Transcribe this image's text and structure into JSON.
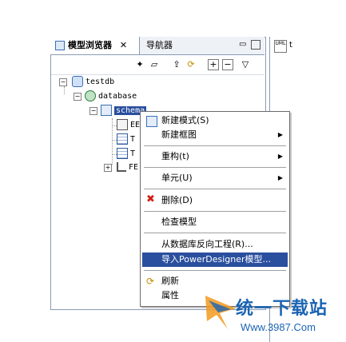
{
  "tabs": {
    "model_browser": "模型浏览器",
    "navigator": "导航器",
    "right_tab_label": "t"
  },
  "tree": {
    "root": "testdb",
    "database": "database",
    "schema": "schema",
    "child1": "EE",
    "child2": "T",
    "child3": "T",
    "child4": "FE"
  },
  "menu": {
    "items": [
      {
        "label": "新建模式(S)",
        "icon": "schema-icon"
      },
      {
        "label": "新建框图",
        "submenu": true
      },
      {
        "label": "重构(t)",
        "submenu": true
      },
      {
        "label": "单元(U)",
        "submenu": true
      },
      {
        "label": "删除(D)",
        "icon": "delete-icon"
      },
      {
        "label": "检查模型"
      },
      {
        "label": "从数据库反向工程(R)..."
      },
      {
        "label": "导入PowerDesigner模型...",
        "selected": true
      },
      {
        "label": "刷新",
        "icon": "refresh-icon"
      },
      {
        "label": "属性"
      }
    ]
  },
  "watermark": {
    "brand": "统一下载站",
    "url": "Www.3987.Com"
  },
  "colors": {
    "selection": "#2a4f9e",
    "border": "#8a9bb5",
    "watermark_blue": "#1b64b3"
  }
}
